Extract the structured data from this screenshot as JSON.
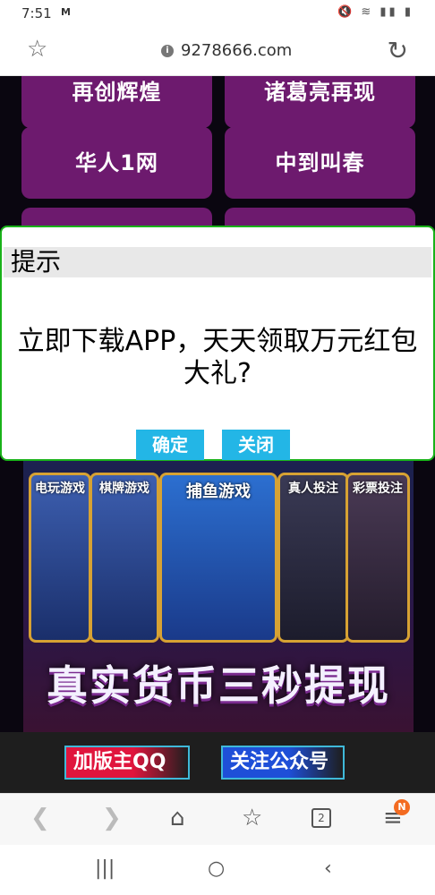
{
  "status_bar": {
    "time": "7:51",
    "carrier_icon": "M",
    "icons": "mute wifi signal battery"
  },
  "browser": {
    "url": "9278666.com"
  },
  "grid_buttons": [
    {
      "label": "再创辉煌"
    },
    {
      "label": "诸葛亮再现"
    },
    {
      "label": "华人1网"
    },
    {
      "label": "中到叫春"
    }
  ],
  "banner": {
    "cards": [
      "电玩游戏",
      "棋牌游戏",
      "捕鱼游戏",
      "真人投注",
      "彩票投注"
    ],
    "slogan": "真实货币三秒提现"
  },
  "dialog": {
    "title": "提示",
    "message": "立即下载APP，天天领取万元红包大礼?",
    "confirm_label": "确定",
    "close_label": "关闭"
  },
  "bottom_bar": {
    "qq_label": "加版主QQ",
    "wechat_label": "关注公众号"
  },
  "nav": {
    "tabs_count": "2",
    "menu_badge": "N"
  },
  "colors": {
    "grid_button": "#6d1a6e",
    "dialog_button": "#23b6e6",
    "dialog_border": "#19b219"
  }
}
